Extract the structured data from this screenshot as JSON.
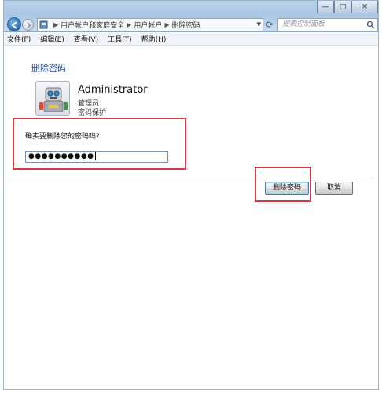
{
  "window": {
    "breadcrumbs": [
      "用户帐户和家庭安全",
      "用户帐户",
      "删除密码"
    ],
    "search_placeholder": "搜索控制面板",
    "controls": {
      "minimize": "—",
      "maximize": "□",
      "close": "✕"
    }
  },
  "menu": [
    {
      "label": "文件(F)"
    },
    {
      "label": "编辑(E)"
    },
    {
      "label": "查看(V)"
    },
    {
      "label": "工具(T)"
    },
    {
      "label": "帮助(H)"
    }
  ],
  "page": {
    "heading": "删除密码",
    "account": {
      "name": "Administrator",
      "role": "管理员",
      "status": "密码保护"
    },
    "prompt": "确实要删除您的密码吗?",
    "password_value": "●●●●●●●●●●"
  },
  "buttons": {
    "delete": "删除密码",
    "cancel": "取消"
  },
  "colors": {
    "heading": "#1e3f8a",
    "highlight_box": "#d23b46",
    "title_bar": "#b9d3ea"
  }
}
